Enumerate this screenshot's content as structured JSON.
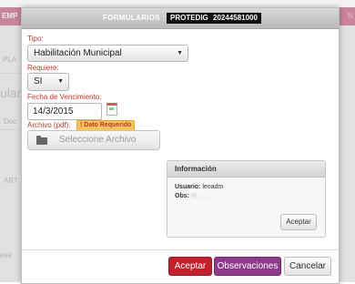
{
  "background": {
    "topbar_left": "EMP",
    "topbar_right": "N",
    "left_labels": [
      "PLA",
      "ular",
      "Doc",
      "ART",
      "esa"
    ]
  },
  "dialog": {
    "title_label": "FORMULARIOS :",
    "title_tags": [
      "PROTEDIG",
      "20244581000"
    ]
  },
  "form": {
    "tipo_label": "Tipo:",
    "tipo_value": "Habilitación Municipal",
    "requiere_label": "Requiere:",
    "requiere_value": "SI",
    "fecha_label": "Fecha de Vencimiento:",
    "fecha_value": "14/3/2015",
    "archivo_label": "Archivo (pdf):",
    "required_badge": "! Dato Requerido",
    "file_button": "Seleccione Archivo"
  },
  "info": {
    "title": "Información",
    "user_label": "Usuario:",
    "user_value": "leoadm",
    "obs_label": "Obs:",
    "obs_value": "re     ,    ,    .    ,",
    "ok_button": "Aceptar"
  },
  "footer": {
    "accept": "Aceptar",
    "observaciones": "Observaciones",
    "cancel": "Cancelar"
  },
  "colors": {
    "accept_btn": "#c0212c",
    "observaciones_btn": "#8e3b8a",
    "label_red": "#c0392b"
  }
}
